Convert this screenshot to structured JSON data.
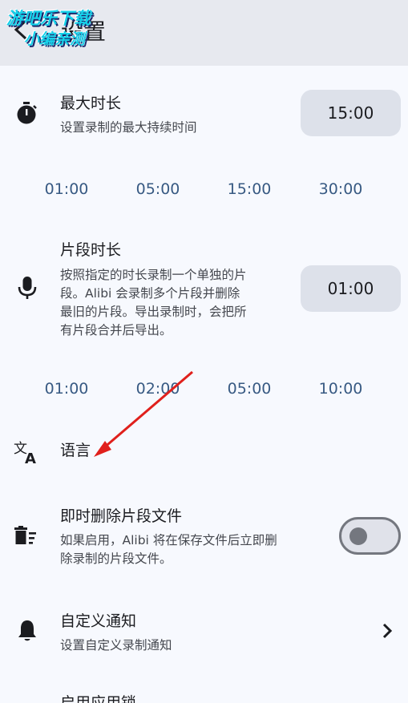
{
  "header": {
    "title": "设置",
    "watermark_line1": "游吧乐下载",
    "watermark_line2": "小编亲测"
  },
  "max_duration": {
    "title": "最大时长",
    "description": "设置录制的最大持续时间",
    "value": "15:00",
    "options": [
      "01:00",
      "05:00",
      "15:00",
      "30:00"
    ]
  },
  "segment_duration": {
    "title": "片段时长",
    "description_lines": [
      "按照指定的时长录制一个单独的片",
      "段。Alibi 会录制多个片段并删除",
      "最旧的片段。导出录制时，会把所",
      "有片段合并后导出。"
    ],
    "value": "01:00",
    "options": [
      "01:00",
      "02:00",
      "05:00",
      "10:00"
    ]
  },
  "language": {
    "title": "语言"
  },
  "delete_segments": {
    "title": "即时删除片段文件",
    "description_lines": [
      "如果启用，Alibi 将在保存文件后立即删",
      "除录制的片段文件。"
    ],
    "enabled": false
  },
  "custom_notification": {
    "title": "自定义通知",
    "description": "设置自定义录制通知"
  },
  "app_lock": {
    "title": "启用应用锁"
  },
  "colors": {
    "accent": "#385a83",
    "annotation_arrow": "#e0201c"
  },
  "icons": [
    "back-arrow-icon",
    "timer-icon",
    "microphone-icon",
    "translate-icon",
    "delete-sweep-icon",
    "bell-icon",
    "chevron-right-icon"
  ]
}
